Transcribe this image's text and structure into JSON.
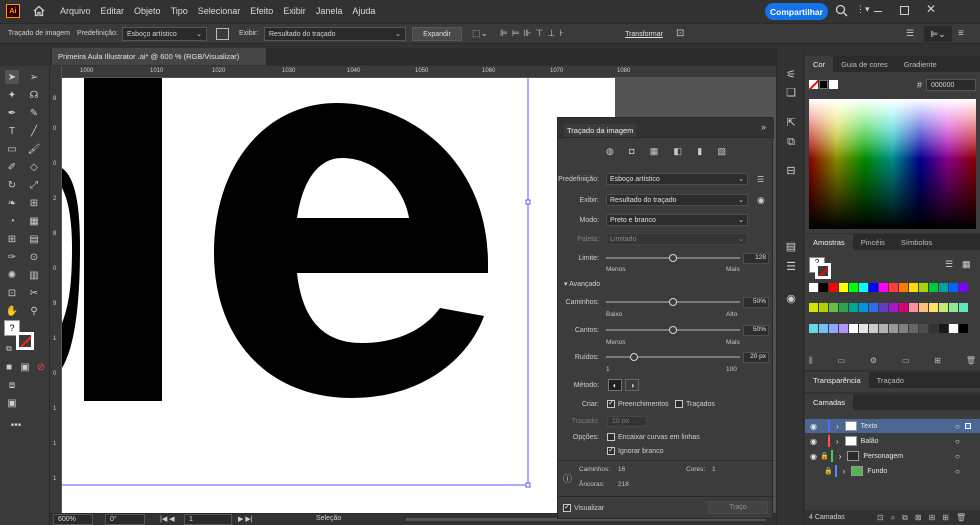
{
  "app": {
    "logo": "Ai",
    "menus": [
      "Arquivo",
      "Editar",
      "Objeto",
      "Tipo",
      "Selecionar",
      "Efeito",
      "Exibir",
      "Janela",
      "Ajuda"
    ],
    "share_label": "Compartilhar"
  },
  "control": {
    "context": "Traçado de imagem",
    "preset_label": "Predefinição:",
    "preset_value": "Esboço artístico",
    "view_label": "Exibir:",
    "view_value": "Resultado do traçado",
    "expand": "Expandir",
    "transform": "Transformar"
  },
  "document": {
    "tab_title": "Primeira Aula Illustrator .ai* @ 600 % (RGB/Visualizar)"
  },
  "ruler": {
    "h_ticks": [
      "1000",
      "1010",
      "1020",
      "1030",
      "1040",
      "1050",
      "1060",
      "1070",
      "1080"
    ],
    "v_ticks": [
      "8",
      "0",
      "0",
      "2",
      "8",
      "0",
      "9",
      "1",
      "0",
      "1",
      "1",
      "1"
    ]
  },
  "status": {
    "zoom": "600%",
    "rotate": "0°",
    "artboard": "1",
    "tool": "Seleção"
  },
  "trace_panel": {
    "title": "Traçado da imagem",
    "preset_label": "Predefinição:",
    "preset_value": "Esboço artístico",
    "view_label": "Exibir:",
    "view_value": "Resultado do traçado",
    "mode_label": "Modo:",
    "mode_value": "Preto e branco",
    "palette_label": "Paleta:",
    "palette_value": "Limitado",
    "limit_label": "Limite:",
    "limit_value": "128",
    "limit_min": "Menos",
    "limit_max": "Mais",
    "advanced_label": "Avançado",
    "paths_label": "Caminhos:",
    "paths_value": "50%",
    "paths_min": "Baixo",
    "paths_max": "Alto",
    "corners_label": "Cantos:",
    "corners_value": "50%",
    "corners_min": "Menos",
    "corners_max": "Mais",
    "noise_label": "Ruídos:",
    "noise_value": "20 px",
    "noise_min": "1",
    "noise_max": "100",
    "method_label": "Método:",
    "create_label": "Criar:",
    "fills_label": "Preenchimentos",
    "strokes_label": "Traçados",
    "stroke_label": "Traçado:",
    "stroke_value": "10 px",
    "options_label": "Opções:",
    "snap_label": "Encaixar curvas em linhas",
    "ignore_label": "Ignorar branco",
    "paths_count_label": "Caminhos:",
    "paths_count": "16",
    "colors_label": "Cores:",
    "colors_count": "1",
    "anchors_label": "Âncoras:",
    "anchors_count": "218",
    "preview_label": "Visualizar",
    "trace_button": "Traço"
  },
  "color_panel": {
    "tabs": [
      "Cor",
      "Guia de cores",
      "Gradiente"
    ],
    "hex": "000000"
  },
  "swatches_panel": {
    "tabs": [
      "Amostras",
      "Pincéis",
      "Símbolos"
    ]
  },
  "transparency_panel": {
    "tabs": [
      "Transparência",
      "Traçado"
    ]
  },
  "layers_panel": {
    "tab": "Camadas",
    "count_label": "4 Camadas",
    "layers": [
      {
        "name": "Texto",
        "color": "#4f6bff"
      },
      {
        "name": "Balão",
        "color": "#ff4f4f"
      },
      {
        "name": "Personagem",
        "color": "#45d245"
      },
      {
        "name": "Fundo",
        "color": "#4f8bff"
      }
    ]
  },
  "swatch_colors": [
    "#ffffff",
    "#000000",
    "#ff0000",
    "#ffff00",
    "#00ff00",
    "#00ffff",
    "#0000ff",
    "#ff00ff",
    "#ff3b3b",
    "#ff7a00",
    "#ffde00",
    "#a6d608",
    "#00c83c",
    "#00a3a3",
    "#0066ff",
    "#7a00ff",
    "#d6e500",
    "#b4d400",
    "#6bbd45",
    "#2da44e",
    "#00a88f",
    "#0098d8",
    "#2d6ee8",
    "#5f3dc4",
    "#a21cc6",
    "#d6007b",
    "#ff8fa3",
    "#ffc078",
    "#ffe066",
    "#c0eb75",
    "#8ce99a",
    "#63e6be",
    "#66d9e8",
    "#74c0fc",
    "#91a7ff",
    "#b197fc",
    "#ffffff",
    "#e6e6e6",
    "#cccccc",
    "#b3b3b3",
    "#999999",
    "#808080",
    "#666666",
    "#4d4d4d",
    "#333333",
    "#1a1a1a",
    "#ffffff",
    "#000000"
  ]
}
